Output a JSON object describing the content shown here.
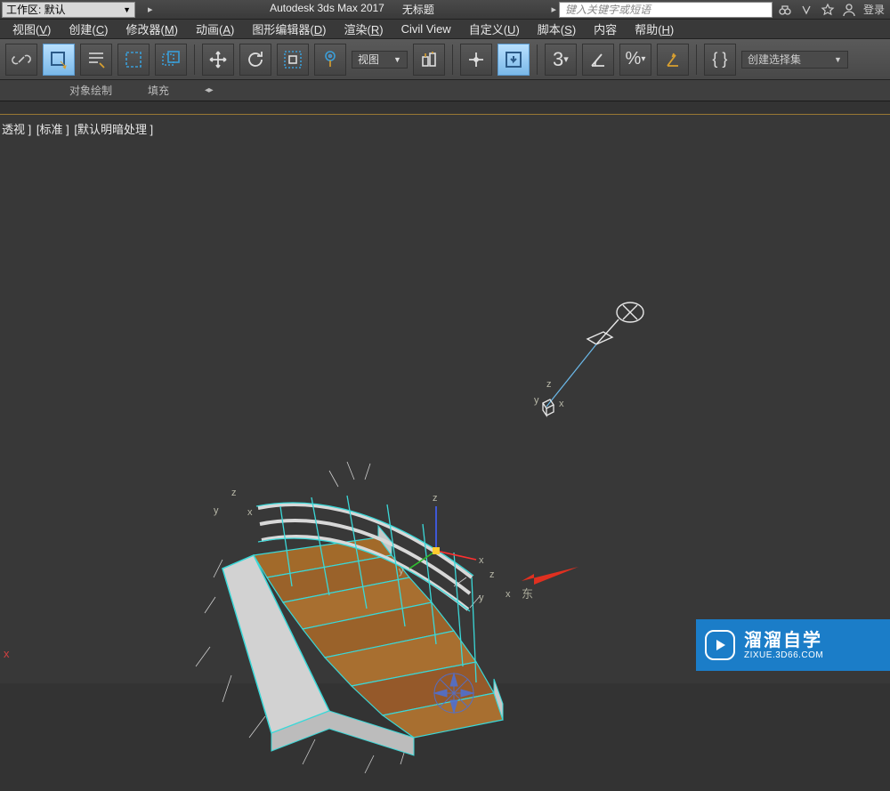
{
  "titlebar": {
    "workspace_label": "工作区: 默认",
    "app_title": "Autodesk 3ds Max 2017",
    "doc_title": "无标题",
    "search_placeholder": "键入关键字或短语",
    "login_label": "登录"
  },
  "menubar": {
    "items": [
      {
        "label": "视图",
        "key": "V"
      },
      {
        "label": "创建",
        "key": "C"
      },
      {
        "label": "修改器",
        "key": "M"
      },
      {
        "label": "动画",
        "key": "A"
      },
      {
        "label": "图形编辑器",
        "key": "D"
      },
      {
        "label": "渲染",
        "key": "R"
      },
      {
        "label": "Civil View",
        "key": ""
      },
      {
        "label": "自定义",
        "key": "U"
      },
      {
        "label": "脚本",
        "key": "S"
      },
      {
        "label": "内容",
        "key": ""
      },
      {
        "label": "帮助",
        "key": "H"
      }
    ]
  },
  "toolbar": {
    "view_dropdown": "视图",
    "three_label": "3",
    "percent_label": "%",
    "braces_label": "{ }",
    "selection_set_label": "创建选择集"
  },
  "subbar": {
    "object_paint": "对象绘制",
    "fill": "填充"
  },
  "viewport": {
    "label_parts": [
      "透视 ]",
      "[标准 ]",
      "[默认明暗处理 ]"
    ],
    "east_label": "东",
    "axis": {
      "x": "x",
      "y": "y",
      "z": "z"
    },
    "origin_marker": "x"
  },
  "watermark": {
    "cn": "溜溜自学",
    "url": "ZIXUE.3D66.COM"
  }
}
